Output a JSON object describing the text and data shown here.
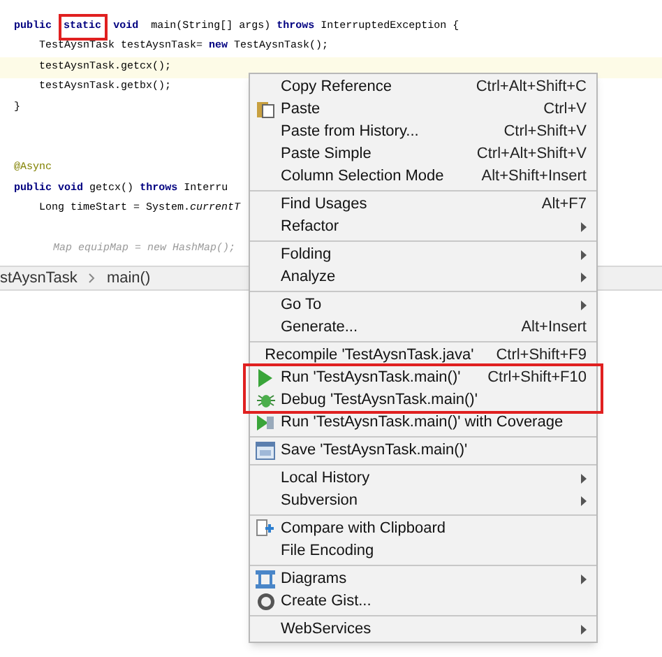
{
  "editor": {
    "lines": [
      {
        "kind": "declaration",
        "segments": [
          {
            "text": "**public** "
          },
          {
            "text": "**static**",
            "boxed": true
          },
          {
            "text": " **void**  main(String[] args) **throws** InterruptedException {"
          }
        ]
      },
      {
        "kind": "statement",
        "segments": [
          {
            "text": "TestAysnTask testAysnTask= **new** TestAysnTask();"
          }
        ]
      },
      {
        "kind": "statement",
        "current": true,
        "segments": [
          {
            "text": "testAysnTask.getcx();"
          }
        ]
      },
      {
        "kind": "statement",
        "current": false,
        "segments": [
          {
            "text": "testAysnTask.getbx();"
          }
        ]
      },
      {
        "kind": "declaration",
        "segments": [
          {
            "text": "}"
          }
        ]
      },
      {
        "kind": "blank"
      },
      {
        "kind": "blank"
      },
      {
        "kind": "annotation",
        "segments": [
          {
            "text": "@Async"
          }
        ]
      },
      {
        "kind": "declaration",
        "segments": [
          {
            "text": "**public** **void** getcx() **throws** Interru"
          }
        ]
      },
      {
        "kind": "statement",
        "segments": [
          {
            "text": "Long timeStart = System.*currentT*"
          }
        ]
      },
      {
        "kind": "blank"
      },
      {
        "kind": "comment",
        "segments": [
          {
            "text": "Map equipMap = new HashMap();"
          }
        ]
      }
    ]
  },
  "breadcrumb": [
    "stAysnTask",
    "main()"
  ],
  "context_menu": {
    "groups": [
      [
        {
          "label": "Copy Reference",
          "shortcut": "Ctrl+Alt+Shift+C",
          "submenu": false,
          "kind": "plain"
        },
        {
          "label": "Paste",
          "shortcut": "Ctrl+V",
          "submenu": false,
          "kind": "paste"
        },
        {
          "label": "Paste from History...",
          "shortcut": "Ctrl+Shift+V",
          "submenu": false,
          "kind": "plain"
        },
        {
          "label": "Paste Simple",
          "shortcut": "Ctrl+Alt+Shift+V",
          "submenu": false,
          "kind": "plain"
        },
        {
          "label": "Column Selection Mode",
          "shortcut": "Alt+Shift+Insert",
          "submenu": false,
          "kind": "plain"
        }
      ],
      [
        {
          "label": "Find Usages",
          "shortcut": "Alt+F7",
          "submenu": false,
          "kind": "plain"
        },
        {
          "label": "Refactor",
          "submenu": true,
          "kind": "plain"
        }
      ],
      [
        {
          "label": "Folding",
          "submenu": true,
          "kind": "plain"
        },
        {
          "label": "Analyze",
          "submenu": true,
          "kind": "plain"
        }
      ],
      [
        {
          "label": "Go To",
          "submenu": true,
          "kind": "plain"
        },
        {
          "label": "Generate...",
          "shortcut": "Alt+Insert",
          "submenu": false,
          "kind": "plain"
        }
      ],
      [
        {
          "label": "Recompile 'TestAysnTask.java'",
          "shortcut": "Ctrl+Shift+F9",
          "submenu": false,
          "kind": "plain"
        },
        {
          "label": "Run 'TestAysnTask.main()'",
          "shortcut": "Ctrl+Shift+F10",
          "submenu": false,
          "kind": "run",
          "framed": true
        },
        {
          "label": "Debug 'TestAysnTask.main()'",
          "submenu": false,
          "kind": "debug",
          "framed": true
        },
        {
          "label": "Run 'TestAysnTask.main()' with Coverage",
          "submenu": false,
          "kind": "coverage",
          "framed": false
        }
      ],
      [
        {
          "label": "Save 'TestAysnTask.main()'",
          "submenu": false,
          "kind": "save"
        }
      ],
      [
        {
          "label": "Local History",
          "submenu": true,
          "kind": "plain"
        },
        {
          "label": "Subversion",
          "submenu": true,
          "kind": "plain"
        }
      ],
      [
        {
          "label": "Compare with Clipboard",
          "submenu": false,
          "kind": "compare"
        },
        {
          "label": "File Encoding",
          "submenu": false,
          "kind": "plain"
        }
      ],
      [
        {
          "label": "Diagrams",
          "submenu": true,
          "kind": "diagrams"
        },
        {
          "label": "Create Gist...",
          "submenu": false,
          "kind": "gist"
        }
      ],
      [
        {
          "label": "WebServices",
          "submenu": true,
          "kind": "plain"
        }
      ]
    ]
  }
}
